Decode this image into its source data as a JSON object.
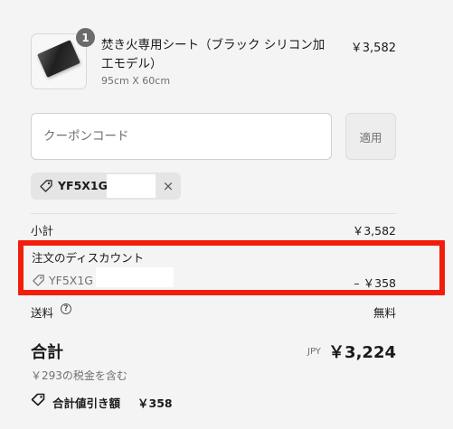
{
  "product": {
    "title": "焚き火専用シート（ブラック シリコン加工モデル）",
    "variant": "95cm X 60cm",
    "price": "￥3,582",
    "quantity": "1",
    "image_icon": "sheet-thumbnail"
  },
  "coupon": {
    "placeholder": "クーポンコード",
    "value": "",
    "apply_label": "適用"
  },
  "applied_code": {
    "code": "YF5X1G",
    "remove_icon": "×"
  },
  "summary": {
    "subtotal_label": "小計",
    "subtotal_value": "￥3,582",
    "discount_label": "注文のディスカウント",
    "discount_code": "YF5X1G",
    "discount_value": "– ￥358",
    "shipping_label": "送料",
    "shipping_help": "?",
    "shipping_value": "無料",
    "total_label": "合計",
    "currency": "JPY",
    "total_value": "￥3,224",
    "tax_note": "￥293の税金を含む",
    "savings_label": "合計値引き額",
    "savings_value": "￥358"
  },
  "colors": {
    "highlight": "#f21d0a",
    "background": "#f5f4f4",
    "muted_text": "#707070"
  }
}
